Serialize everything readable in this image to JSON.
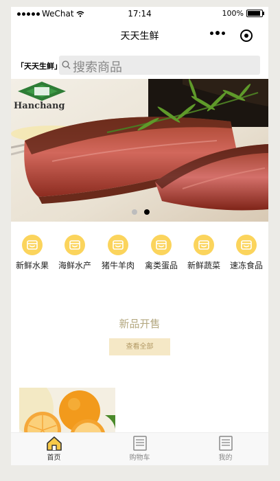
{
  "status_bar": {
    "carrier": "WeChat",
    "time": "17:14",
    "battery": "100%"
  },
  "nav": {
    "title": "天天生鲜"
  },
  "search": {
    "brand": "「天天生鲜」",
    "placeholder": "搜索商品"
  },
  "banner": {
    "slide_count": 2,
    "active_slide": 2,
    "logo_text": "Hanchang"
  },
  "categories": [
    {
      "label": "新鲜水果",
      "icon": "store-icon"
    },
    {
      "label": "海鲜水产",
      "icon": "store-icon"
    },
    {
      "label": "猪牛羊肉",
      "icon": "store-icon"
    },
    {
      "label": "禽类蛋品",
      "icon": "store-icon"
    },
    {
      "label": "新鲜蔬菜",
      "icon": "store-icon"
    },
    {
      "label": "速冻食品",
      "icon": "store-icon"
    }
  ],
  "section": {
    "title": "新品开售",
    "view_all": "查看全部"
  },
  "tabbar": {
    "items": [
      {
        "label": "首页",
        "icon": "home-icon",
        "active": true
      },
      {
        "label": "购物车",
        "icon": "document-icon",
        "active": false
      },
      {
        "label": "我的",
        "icon": "document-icon",
        "active": false
      }
    ]
  },
  "colors": {
    "accent": "#fbd45c",
    "tab_active": "#333333",
    "tab_inactive": "#888888",
    "section_title": "#b4a880"
  }
}
